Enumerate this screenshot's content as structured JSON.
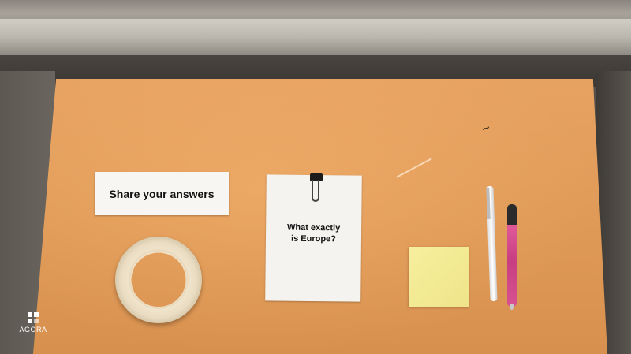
{
  "photo": {
    "card_text": "Share your answers",
    "paper_question_line1": "What exactly",
    "paper_question_line2": "is Europe?",
    "logo_text": "ÁGORA",
    "logo_icon": "agora-logo-icon"
  },
  "colors": {
    "board": "#e09a58",
    "sticky_note": "#f5ec97",
    "pen_pink": "#d8518f"
  }
}
